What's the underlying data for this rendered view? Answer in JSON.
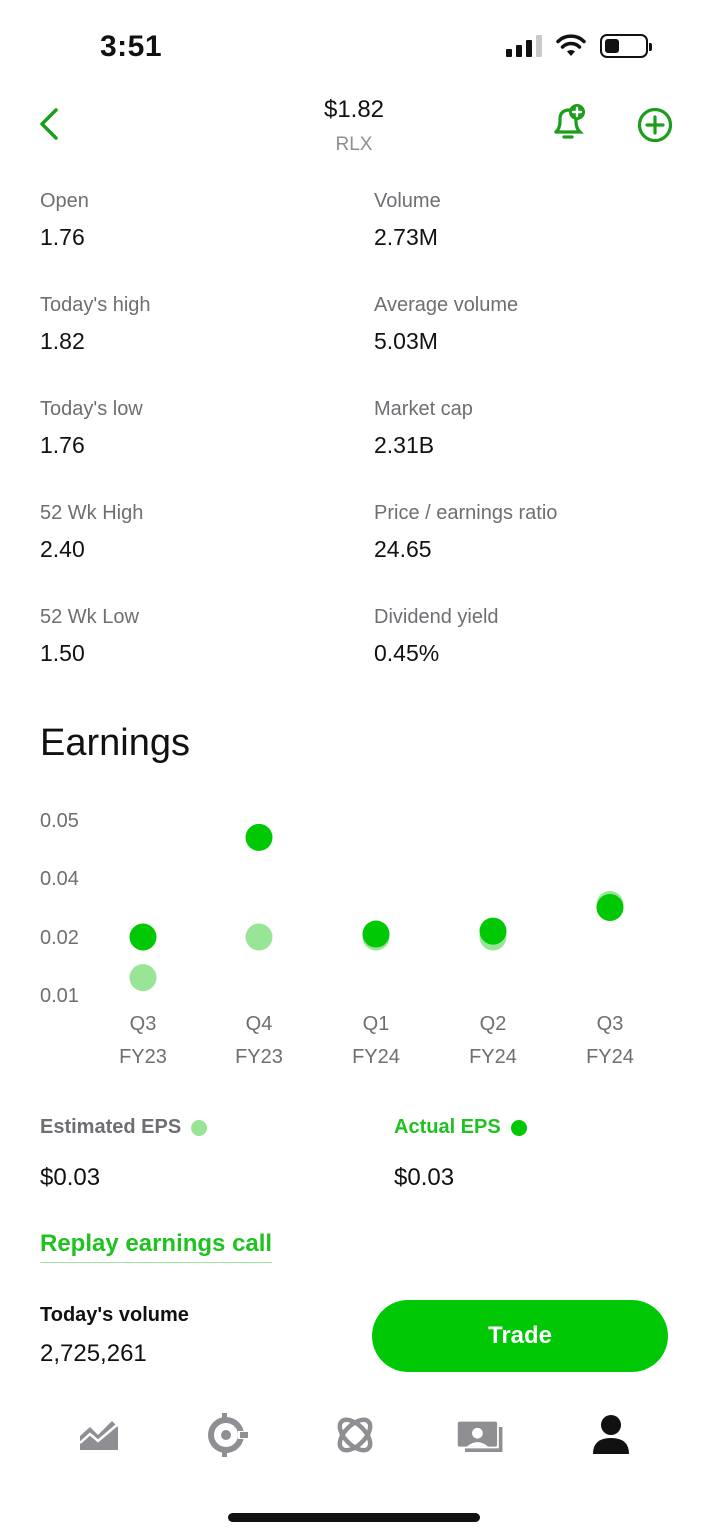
{
  "status_bar": {
    "time": "3:51"
  },
  "header": {
    "price": "$1.82",
    "ticker": "RLX"
  },
  "stats": [
    {
      "label": "Open",
      "value": "1.76"
    },
    {
      "label": "Volume",
      "value": "2.73M"
    },
    {
      "label": "Today's high",
      "value": "1.82"
    },
    {
      "label": "Average volume",
      "value": "5.03M"
    },
    {
      "label": "Today's low",
      "value": "1.76"
    },
    {
      "label": "Market cap",
      "value": "2.31B"
    },
    {
      "label": "52 Wk High",
      "value": "2.40"
    },
    {
      "label": "Price / earnings ratio",
      "value": "24.65"
    },
    {
      "label": "52 Wk Low",
      "value": "1.50"
    },
    {
      "label": "Dividend yield",
      "value": "0.45%"
    }
  ],
  "earnings": {
    "title": "Earnings",
    "estimated_label": "Estimated EPS",
    "estimated_value": "$0.03",
    "actual_label": "Actual EPS",
    "actual_value": "$0.03",
    "replay_label": "Replay earnings call"
  },
  "chart_data": {
    "type": "scatter",
    "y_ticks": [
      "0.05",
      "0.04",
      "0.02",
      "0.01"
    ],
    "categories": [
      {
        "q": "Q3",
        "fy": "FY23"
      },
      {
        "q": "Q4",
        "fy": "FY23"
      },
      {
        "q": "Q1",
        "fy": "FY24"
      },
      {
        "q": "Q2",
        "fy": "FY24"
      },
      {
        "q": "Q3",
        "fy": "FY24"
      }
    ],
    "series": [
      {
        "name": "Estimated EPS",
        "color": "#98e598",
        "values": [
          0.013,
          0.02,
          0.02,
          0.02,
          0.031
        ]
      },
      {
        "name": "Actual EPS",
        "color": "#00c805",
        "values": [
          0.02,
          0.047,
          0.021,
          0.022,
          0.03
        ]
      }
    ]
  },
  "volume": {
    "label": "Today's volume",
    "value": "2,725,261"
  },
  "trade_button": {
    "label": "Trade"
  },
  "tabbar": {
    "icons": [
      "chart-icon",
      "crypto-icon",
      "browse-icon",
      "cash-icon",
      "account-icon"
    ]
  },
  "colors": {
    "accent": "#00c805",
    "accent_light": "#98e598",
    "text_secondary": "#6e6e73"
  }
}
